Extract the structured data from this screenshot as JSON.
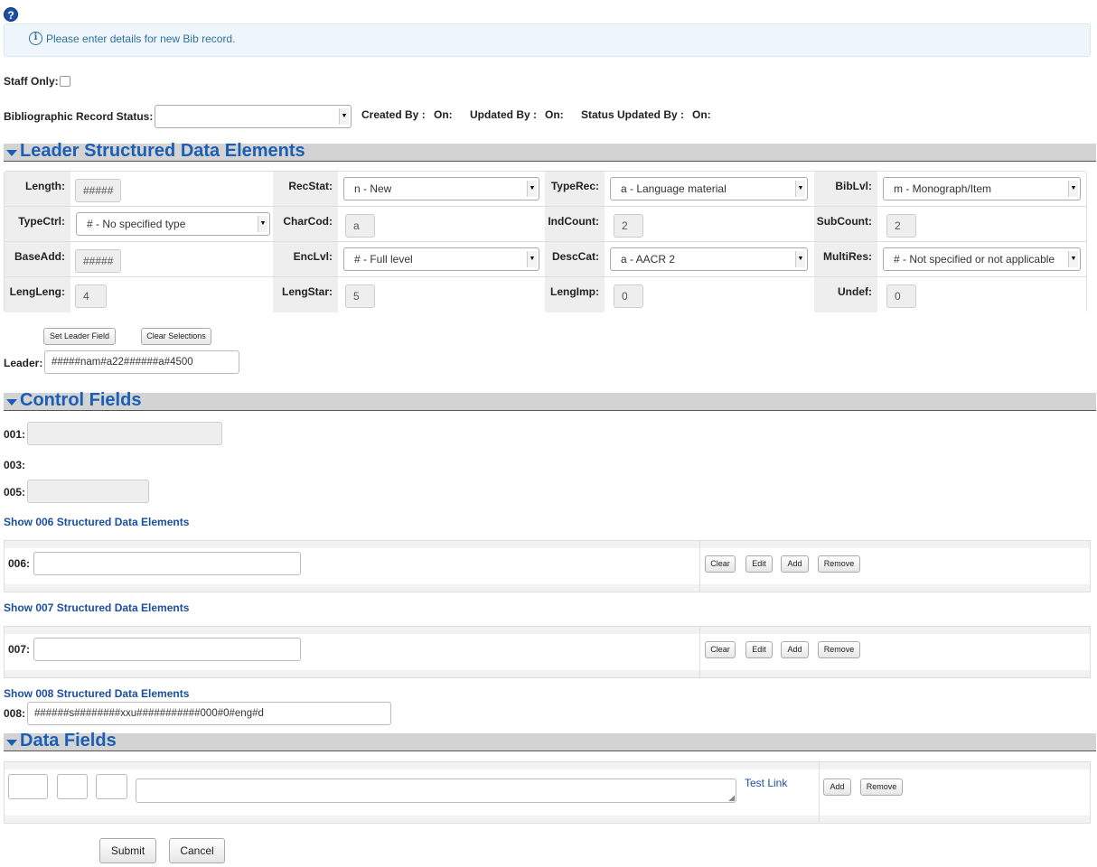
{
  "help_icon": "?",
  "info": {
    "icon": "i",
    "message": "Please enter details for new Bib record."
  },
  "staff_only_label": "Staff Only:",
  "status_row": {
    "bib_status_label": "Bibliographic Record Status:",
    "bib_status_value": "",
    "created_by": "Created By :",
    "created_on": "On:",
    "updated_by": "Updated By :",
    "updated_on": "On:",
    "status_updated_by": "Status Updated By :",
    "status_updated_on": "On:"
  },
  "sections": {
    "leader": "Leader Structured Data Elements",
    "control": "Control Fields",
    "data": "Data Fields"
  },
  "leader": {
    "rows": [
      [
        {
          "label": "Length:",
          "type": "readonly",
          "value": "#####"
        },
        {
          "label": "RecStat:",
          "type": "select",
          "value": "n - New"
        },
        {
          "label": "TypeRec:",
          "type": "select",
          "value": "a - Language material"
        },
        {
          "label": "BibLvl:",
          "type": "select",
          "value": "m - Monograph/Item"
        }
      ],
      [
        {
          "label": "TypeCtrl:",
          "type": "select",
          "value": "# - No specified type"
        },
        {
          "label": "CharCod:",
          "type": "readonly",
          "value": "a"
        },
        {
          "label": "IndCount:",
          "type": "readonly",
          "value": "2"
        },
        {
          "label": "SubCount:",
          "type": "readonly",
          "value": "2"
        }
      ],
      [
        {
          "label": "BaseAdd:",
          "type": "readonly",
          "value": "#####"
        },
        {
          "label": "EncLvl:",
          "type": "select",
          "value": "# - Full level"
        },
        {
          "label": "DescCat:",
          "type": "select",
          "value": "a - AACR 2"
        },
        {
          "label": "MultiRes:",
          "type": "select",
          "value": "# - Not specified or not applicable"
        }
      ],
      [
        {
          "label": "LengLeng:",
          "type": "readonly",
          "value": "4"
        },
        {
          "label": "LengStar:",
          "type": "readonly",
          "value": "5"
        },
        {
          "label": "LengImp:",
          "type": "readonly",
          "value": "0"
        },
        {
          "label": "Undef:",
          "type": "readonly",
          "value": "0"
        }
      ]
    ],
    "set_button": "Set Leader Field",
    "clear_button": "Clear Selections",
    "leader_label": "Leader:",
    "leader_value": "#####nam#a22######a#4500"
  },
  "control": {
    "f001_label": "001:",
    "f001_value": "",
    "f003_label": "003:",
    "f005_label": "005:",
    "f005_value": "",
    "show006": "Show 006 Structured Data Elements",
    "f006_label": "006:",
    "f006_value": "",
    "show007": "Show 007 Structured Data Elements",
    "f007_label": "007:",
    "f007_value": "",
    "show008": "Show 008 Structured Data Elements",
    "f008_label": "008:",
    "f008_value": "######s########xxu###########000#0#eng#d",
    "btn_clear": "Clear",
    "btn_edit": "Edit",
    "btn_add": "Add",
    "btn_remove": "Remove"
  },
  "data_fields": {
    "tag_value": "",
    "ind1_value": "",
    "ind2_value": "",
    "content_value": "",
    "test_link": "Test Link",
    "btn_add": "Add",
    "btn_remove": "Remove"
  },
  "footer": {
    "submit": "Submit",
    "cancel": "Cancel"
  }
}
